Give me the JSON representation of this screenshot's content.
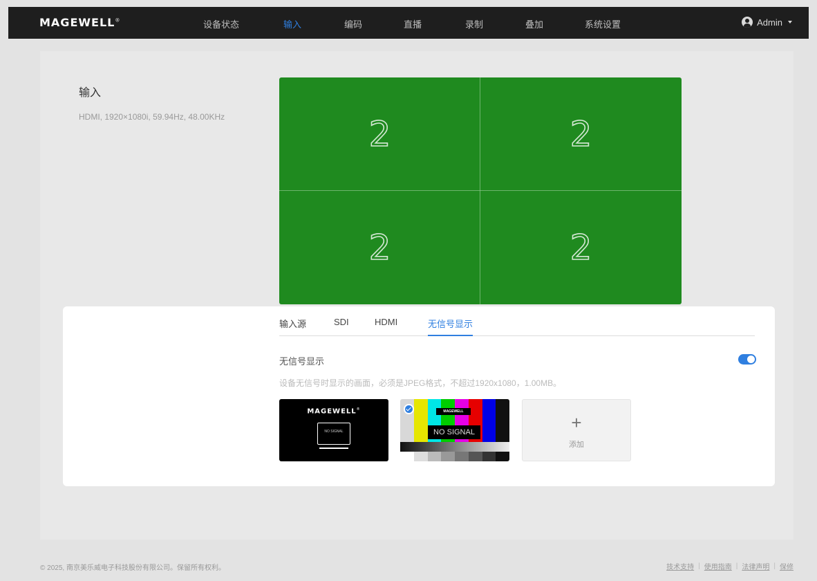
{
  "nav": {
    "logo": "MAGEWELL",
    "logo_mark": "®",
    "items": [
      {
        "label": "设备状态"
      },
      {
        "label": "输入"
      },
      {
        "label": "编码"
      },
      {
        "label": "直播"
      },
      {
        "label": "录制"
      },
      {
        "label": "叠加"
      },
      {
        "label": "系统设置"
      }
    ],
    "active_index": 1,
    "user": "Admin"
  },
  "input": {
    "title": "输入",
    "info": "HDMI, 1920×1080i, 59.94Hz, 48.00KHz"
  },
  "preview": {
    "labels": [
      "2",
      "2",
      "2",
      "2"
    ],
    "background": "#1f8a1f"
  },
  "settings": {
    "tabs": [
      {
        "label": "输入源"
      },
      {
        "label": "SDI"
      },
      {
        "label": "HDMI"
      },
      {
        "label": "无信号显示"
      }
    ],
    "active_tab": 3,
    "no_signal": {
      "label": "无信号显示",
      "enabled": true,
      "hint": "设备无信号时显示的画面，必须是JPEG格式，不超过1920x1080，1.00MB。",
      "images": [
        {
          "logo": "MAGEWELL",
          "logo_mark": "®",
          "text": "NO SIGNAL",
          "selected": false
        },
        {
          "logo": "MAGEWELL",
          "text": "NO SIGNAL",
          "selected": true
        }
      ],
      "add_label": "添加"
    }
  },
  "footer": {
    "copyright": "© 2025, 南京美乐威电子科技股份有限公司。保留所有权利。",
    "links": [
      "技术支持",
      "使用指南",
      "法律声明",
      "保修"
    ]
  },
  "colors": {
    "accent": "#2f7fe0",
    "nav_bg": "#1e1e1e"
  }
}
